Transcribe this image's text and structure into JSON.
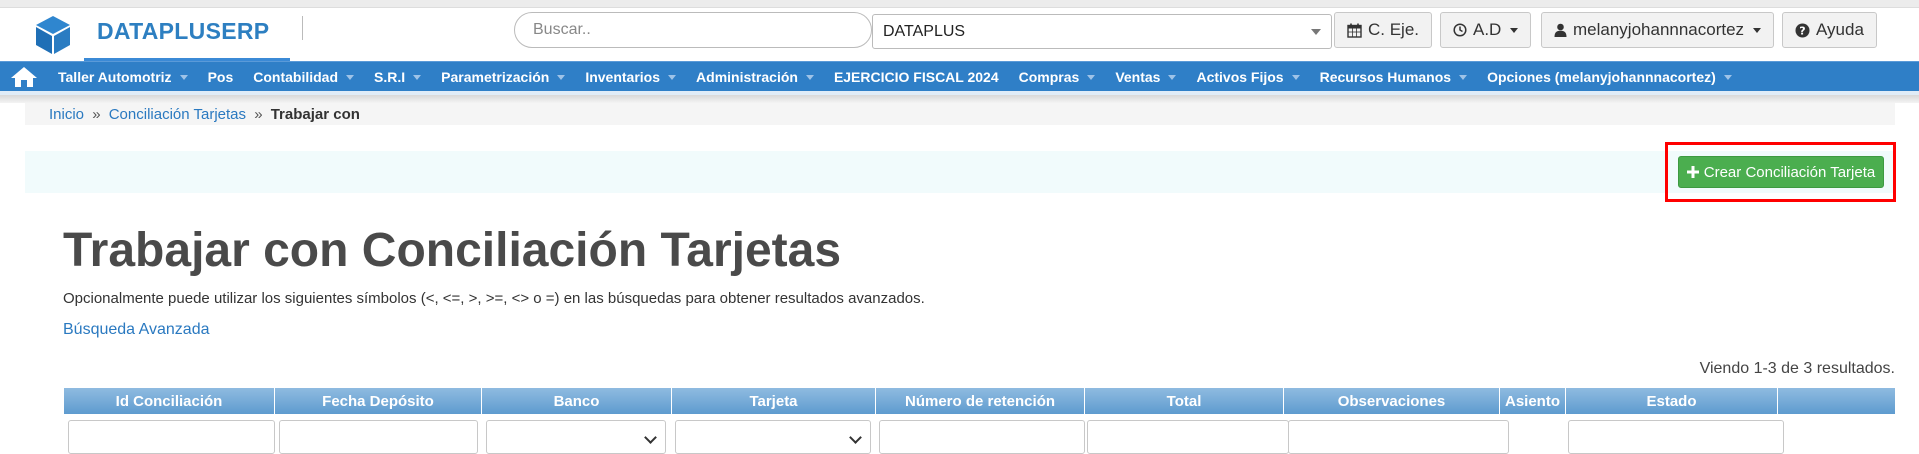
{
  "header": {
    "brand": "DATAPLUSERP",
    "search_placeholder": "Buscar..",
    "company": "DATAPLUS",
    "buttons": {
      "fiscal": "C. Eje.",
      "ad": "A.D",
      "user": "melanyjohannnacortez",
      "help": "Ayuda"
    }
  },
  "nav": {
    "items": [
      "Taller Automotriz",
      "Pos",
      "Contabilidad",
      "S.R.I",
      "Parametrización",
      "Inventarios",
      "Administración",
      "EJERCICIO FISCAL 2024",
      "Compras",
      "Ventas",
      "Activos Fijos",
      "Recursos Humanos",
      "Opciones (melanyjohannnacortez)"
    ]
  },
  "breadcrumb": {
    "home": "Inicio",
    "section": "Conciliación Tarjetas",
    "separator": "»",
    "current": "Trabajar con"
  },
  "actions": {
    "create_label": "Crear Conciliación Tarjeta"
  },
  "page": {
    "title": "Trabajar con Conciliación Tarjetas",
    "hint": "Opcionalmente puede utilizar los siguientes símbolos (<, <=, >, >=, <> o =) en las búsquedas para obtener resultados avanzados.",
    "advanced_search": "Búsqueda Avanzada",
    "results": "Viendo 1-3 de 3 resultados."
  },
  "table": {
    "columns": [
      "Id Conciliación",
      "Fecha Depósito",
      "Banco",
      "Tarjeta",
      "Número de retención",
      "Total",
      "Observaciones",
      "Asiento",
      "Estado",
      ""
    ]
  },
  "colors": {
    "brand_blue": "#2d7fc1",
    "nav_blue": "#2f7fc7",
    "success_green": "#4bae4f",
    "highlight_red": "#ff0000"
  },
  "icons": {
    "logo": "cube-icon",
    "home": "home-icon",
    "fiscal": "calendar-icon",
    "ad": "clock-icon",
    "user": "user-icon",
    "help": "question-circle-icon",
    "create": "plus-icon"
  }
}
